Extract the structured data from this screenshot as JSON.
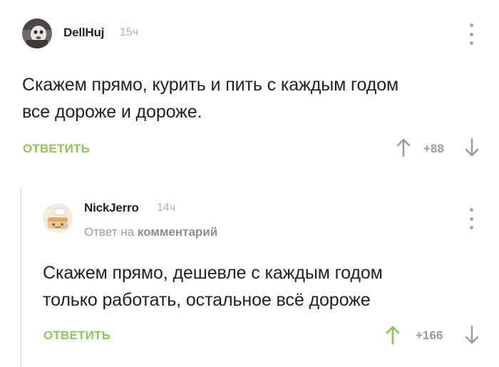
{
  "comments": [
    {
      "author": "DellHuj",
      "time": "15ч",
      "avatar_icon": "user-avatar",
      "text_lines": [
        "Скажем прямо, курить и пить с каждым годом",
        "все дороже и дороже."
      ],
      "reply_label": "ОТВЕТИТЬ",
      "rating": "+88",
      "upvoted": false
    },
    {
      "author": "NickJerro",
      "time": "14ч",
      "avatar_icon": "cartoon-character-avatar",
      "reply_to": {
        "prefix": "Ответ на",
        "link": "комментарий"
      },
      "text_lines": [
        "Скажем прямо, дешевле с каждым годом",
        "только работать, остальное всё дороже"
      ],
      "reply_label": "ОТВЕТИТЬ",
      "rating": "+166",
      "upvoted": true
    }
  ],
  "colors": {
    "accent_green": "#8ac858",
    "muted_gray": "#a7a7a7",
    "text": "#222222"
  },
  "icons": [
    "more-vertical-icon",
    "upvote-arrow-icon",
    "downvote-arrow-icon"
  ]
}
